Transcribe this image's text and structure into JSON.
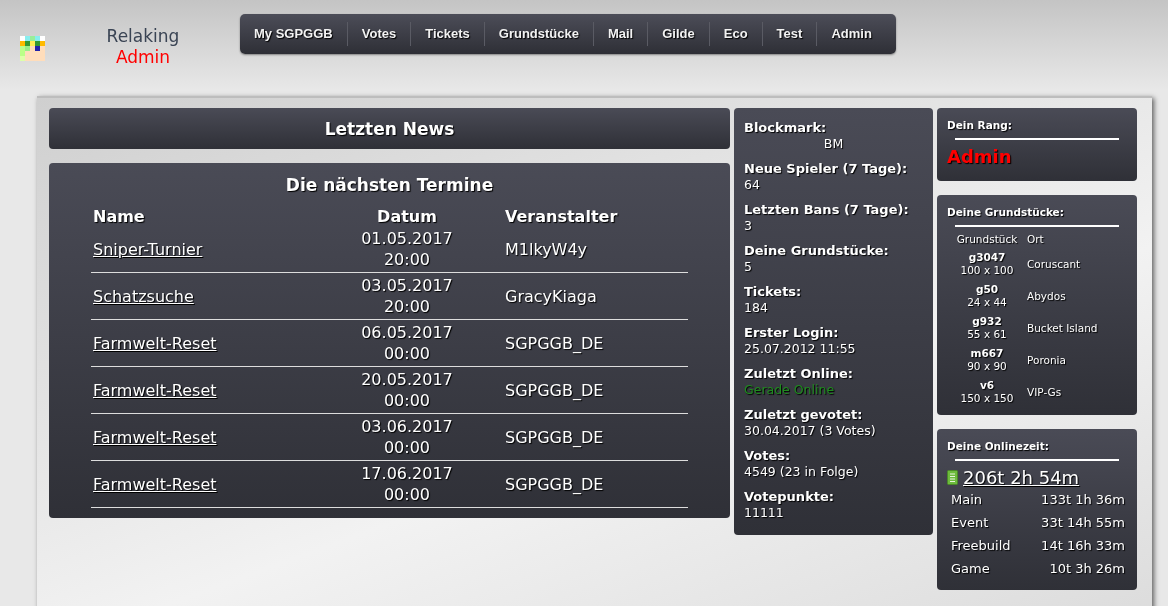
{
  "header": {
    "user": "Relaking",
    "rank": "Admin"
  },
  "nav": [
    "My SGPGGB",
    "Votes",
    "Tickets",
    "Grundstücke",
    "Mail",
    "Gilde",
    "Eco",
    "Test",
    "Admin"
  ],
  "news": {
    "title": "Letzten News"
  },
  "events": {
    "title": "Die nächsten Termine",
    "columns": [
      "Name",
      "Datum",
      "Veranstalter"
    ],
    "rows": [
      {
        "name": "Sniper-Turnier",
        "date": "01.05.2017",
        "time": "20:00",
        "organizer": "M1lkyW4y"
      },
      {
        "name": "Schatzsuche",
        "date": "03.05.2017",
        "time": "20:00",
        "organizer": "GracyKiaga"
      },
      {
        "name": "Farmwelt-Reset",
        "date": "06.05.2017",
        "time": "00:00",
        "organizer": "SGPGGB_DE"
      },
      {
        "name": "Farmwelt-Reset",
        "date": "20.05.2017",
        "time": "00:00",
        "organizer": "SGPGGB_DE"
      },
      {
        "name": "Farmwelt-Reset",
        "date": "03.06.2017",
        "time": "00:00",
        "organizer": "SGPGGB_DE"
      },
      {
        "name": "Farmwelt-Reset",
        "date": "17.06.2017",
        "time": "00:00",
        "organizer": "SGPGGB_DE"
      }
    ]
  },
  "stats": [
    {
      "label": "Blockmark:",
      "value": "BM",
      "kind": "centered"
    },
    {
      "label": "Neue Spieler (7 Tage):",
      "value": "64",
      "kind": "plain"
    },
    {
      "label": "Letzten Bans (7 Tage):",
      "value": "3",
      "kind": "plain"
    },
    {
      "label": "Deine Grundstücke:",
      "value": "5",
      "kind": "plain"
    },
    {
      "label": "Tickets:",
      "value": "184",
      "kind": "plain"
    },
    {
      "label": "Erster Login:",
      "value": "25.07.2012 11:55",
      "kind": "plain"
    },
    {
      "label": "Zuletzt Online:",
      "value": "Gerade Online",
      "kind": "online"
    },
    {
      "label": "Zuletzt gevotet:",
      "value": "30.04.2017 (3 Votes)",
      "kind": "plain"
    },
    {
      "label": "Votes:",
      "value": "4549 (23 in Folge)",
      "kind": "plain"
    },
    {
      "label": "Votepunkte:",
      "value": "11111",
      "kind": "plain"
    }
  ],
  "rank_card": {
    "title": "Dein Rang:",
    "rank": "Admin"
  },
  "plots_card": {
    "title": "Deine Grundstücke:",
    "columns": [
      "Grundstück",
      "Ort"
    ],
    "rows": [
      {
        "id": "g3047",
        "size": "100 x 100",
        "place": "Coruscant"
      },
      {
        "id": "g50",
        "size": "24 x 44",
        "place": "Abydos"
      },
      {
        "id": "g932",
        "size": "55 x 61",
        "place": "Bucket Island"
      },
      {
        "id": "m667",
        "size": "90 x 90",
        "place": "Poronia"
      },
      {
        "id": "v6",
        "size": "150 x 150",
        "place": "VIP-Gs"
      }
    ]
  },
  "online_card": {
    "title": "Deine Onlinezeit:",
    "total": "206t 2h 54m",
    "rows": [
      {
        "server": "Main",
        "time": "133t 1h 36m"
      },
      {
        "server": "Event",
        "time": "33t 14h 55m"
      },
      {
        "server": "Freebuild",
        "time": "14t 16h 33m"
      },
      {
        "server": "Game",
        "time": "10t 3h 26m"
      }
    ]
  }
}
